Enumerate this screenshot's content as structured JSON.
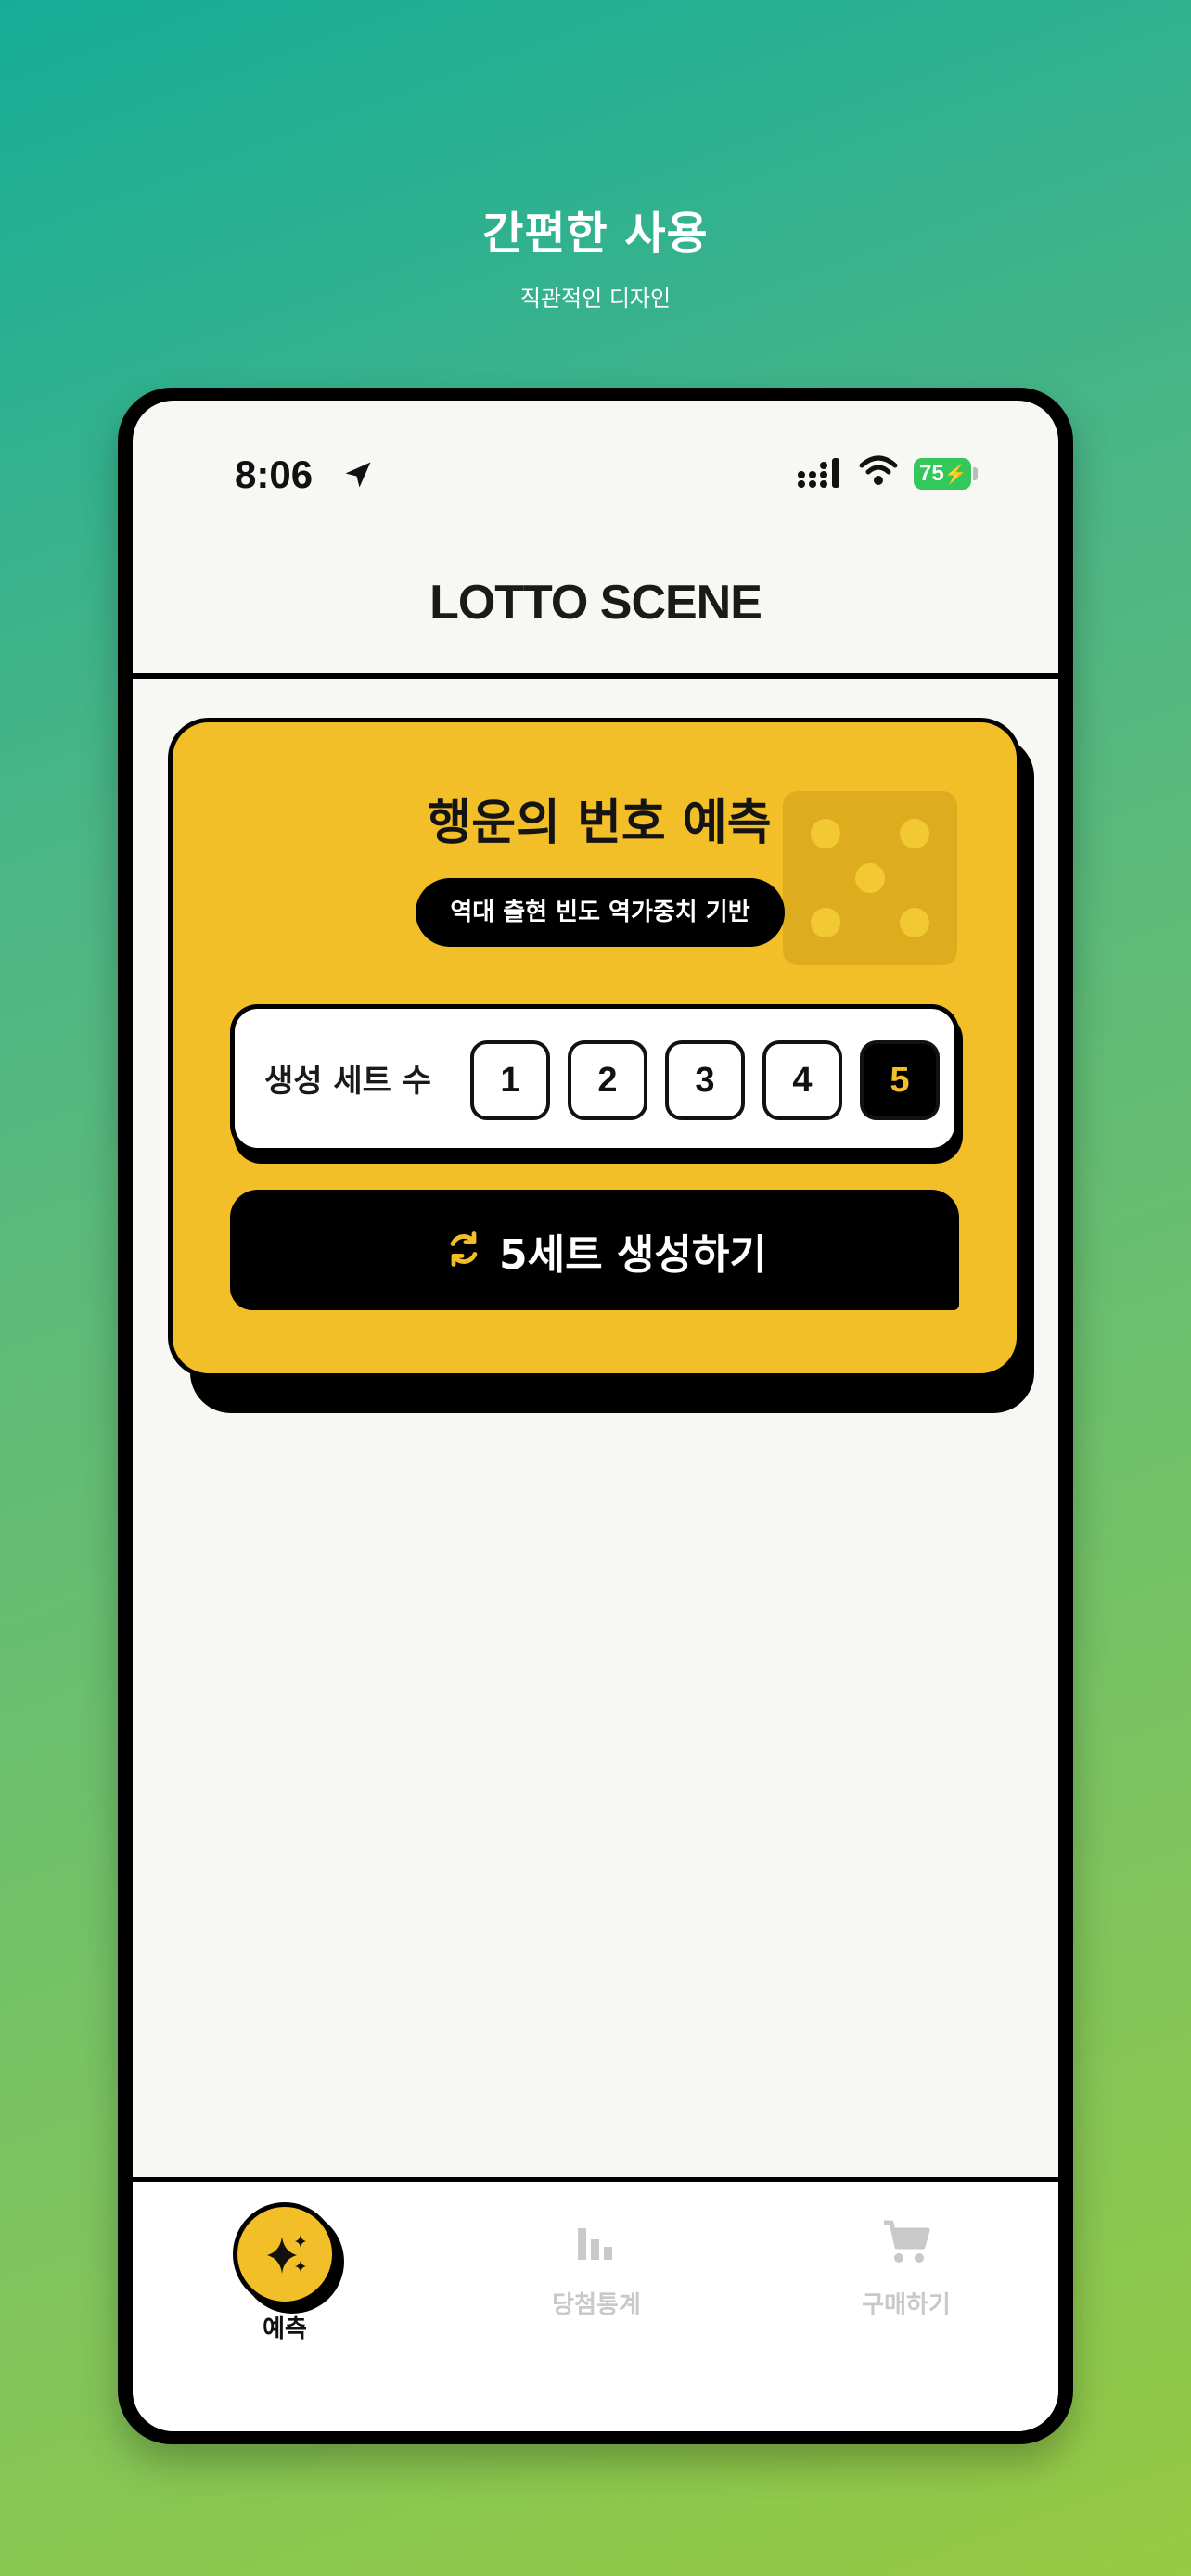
{
  "promo": {
    "title": "간편한 사용",
    "subtitle": "직관적인 디자인"
  },
  "status_bar": {
    "time": "8:06",
    "battery": "75"
  },
  "app": {
    "title": "LOTTO SCENE"
  },
  "prediction_card": {
    "title": "행운의 번호 예측",
    "badge": "역대 출현 빈도 역가중치 기반",
    "sets_label": "생성 세트 수",
    "set_options": [
      "1",
      "2",
      "3",
      "4",
      "5"
    ],
    "selected_set": "5",
    "generate_label": "5세트 생성하기"
  },
  "tabs": [
    {
      "label": "예측",
      "icon": "sparkles-icon",
      "active": true
    },
    {
      "label": "당첨통계",
      "icon": "bar-chart-icon",
      "active": false
    },
    {
      "label": "구매하기",
      "icon": "cart-icon",
      "active": false
    }
  ],
  "colors": {
    "accent_yellow": "#f3bf28",
    "black": "#000000",
    "inactive_tab": "#c9c9c9",
    "battery_green": "#34c759",
    "background_gradient_start": "#16ad98",
    "background_gradient_end": "#97c942"
  }
}
